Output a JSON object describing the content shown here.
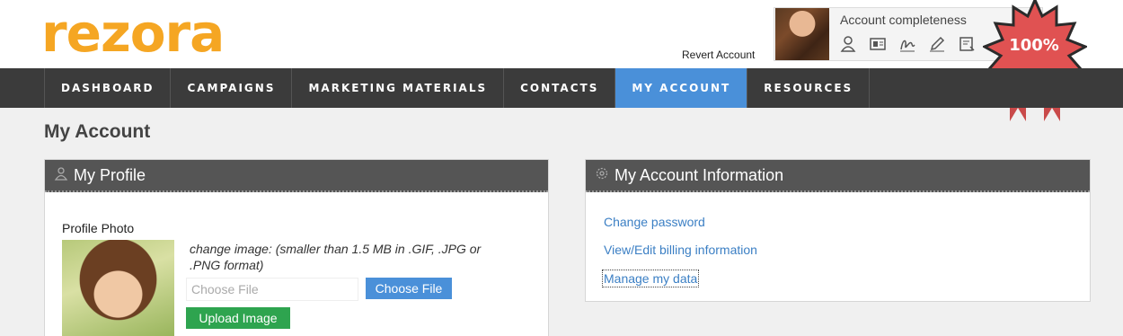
{
  "brand": {
    "logo_text": "rezora",
    "logo_color": "#f5a623"
  },
  "header": {
    "revert_account": "Revert Account",
    "account_completeness_label": "Account completeness",
    "completeness_value": "100%",
    "completeness_fraction": 1.0,
    "icons": [
      "user-icon",
      "id-card-icon",
      "signature-icon",
      "pencil-icon",
      "report-icon"
    ]
  },
  "nav": {
    "items": [
      {
        "label": "DASHBOARD",
        "active": false
      },
      {
        "label": "CAMPAIGNS",
        "active": false
      },
      {
        "label": "MARKETING MATERIALS",
        "active": false
      },
      {
        "label": "CONTACTS",
        "active": false
      },
      {
        "label": "MY ACCOUNT",
        "active": true
      },
      {
        "label": "RESOURCES",
        "active": false
      }
    ],
    "active_color": "#4a90d9"
  },
  "page": {
    "title": "My Account"
  },
  "profile": {
    "header": "My Profile",
    "photo_label": "Profile Photo",
    "change_image_text": "change image: (smaller than 1.5 MB in .GIF, .JPG or .PNG format)",
    "file_placeholder": "Choose File",
    "choose_file_button": "Choose File",
    "upload_button": "Upload Image"
  },
  "account_info": {
    "header": "My Account Information",
    "links": [
      "Change password",
      "View/Edit billing information",
      "Manage my data"
    ]
  }
}
